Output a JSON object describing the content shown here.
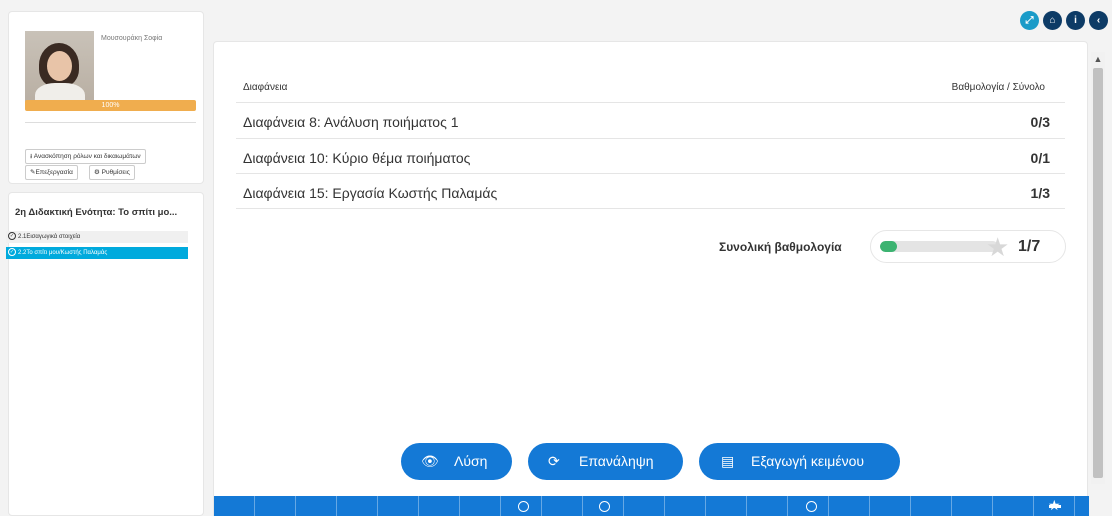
{
  "profile": {
    "name": "Μουσουράκη Σοφία",
    "progress_label": "100%",
    "progress_value": 100,
    "roles_button": "Ανασκόπηση ρόλων και δικαιωμάτων",
    "edit_button": "Επεξεργασία",
    "settings_button": "Ρυθμίσεις"
  },
  "units": {
    "title": "2η Διδακτική Ενότητα: Το σπίτι μο...",
    "items": [
      {
        "label": "2.1Εισαγωγικά στοιχεία",
        "active": false
      },
      {
        "label": "2.2Το σπίτι μου/Κωστής Παλαμάς",
        "active": true
      }
    ]
  },
  "results": {
    "header_left": "Διαφάνεια",
    "header_right": "Βαθμολογία / Σύνολο",
    "rows": [
      {
        "label": "Διαφάνεια 8: Ανάλυση ποιήματος 1",
        "score": "0/3"
      },
      {
        "label": "Διαφάνεια 10: Κύριο θέμα ποιήματος",
        "score": "0/1"
      },
      {
        "label": "Διαφάνεια 15: Εργασία Κωστής Παλαμάς",
        "score": "1/3"
      }
    ],
    "total_label": "Συνολική βαθμολογία",
    "total_score": "1/7",
    "total_fraction": 0.143
  },
  "actions": {
    "solution": "Λύση",
    "retry": "Επανάληψη",
    "export": "Εξαγωγή κειμένου"
  },
  "colors": {
    "accent": "#1479d6",
    "progress": "#f0ad4e",
    "active_unit": "#00aadd",
    "score_fill": "#3cb371"
  },
  "icons": {
    "top": [
      "expand-icon",
      "home-icon",
      "info-icon",
      "back-icon"
    ]
  }
}
